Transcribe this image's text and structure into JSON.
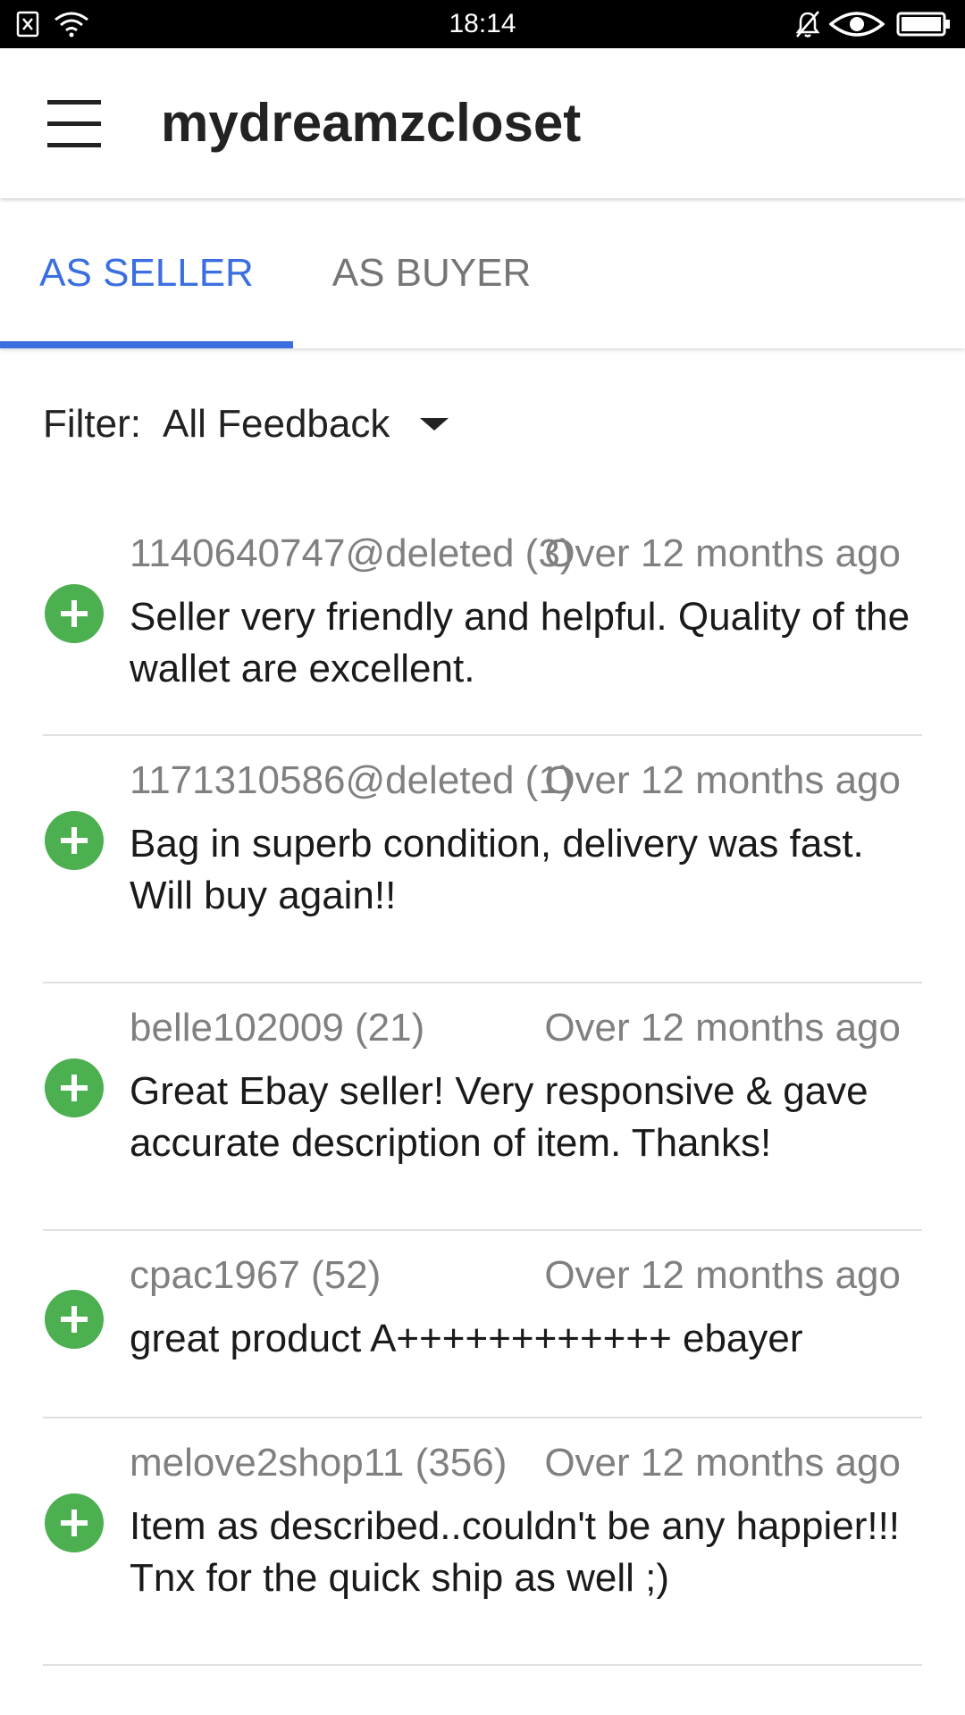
{
  "status_bar": {
    "time": "18:14",
    "icons_left": [
      "sim-card-icon",
      "wifi-icon"
    ],
    "icons_right": [
      "bell-off-icon",
      "eye-icon",
      "battery-icon"
    ]
  },
  "app_bar": {
    "menu_icon": "hamburger-menu-icon",
    "title": "mydreamzcloset"
  },
  "tabs": [
    {
      "label": "AS SELLER",
      "active": true
    },
    {
      "label": "AS BUYER",
      "active": false
    }
  ],
  "filter": {
    "label": "Filter:",
    "value": "All Feedback"
  },
  "colors": {
    "accent": "#3b6fe0",
    "positive": "#4caf50",
    "muted_text": "#808080"
  },
  "feedback": [
    {
      "user": "1140640747@deleted (3)",
      "time": "Over 12 months ago",
      "comment": "Seller very friendly and helpful. Quality of the wallet are excellent.",
      "type": "positive-icon"
    },
    {
      "user": "1171310586@deleted (1)",
      "time": "Over 12 months ago",
      "comment": "Bag in superb condition, delivery was fast. Will buy again!!",
      "type": "positive-icon"
    },
    {
      "user": "belle102009 (21)",
      "time": "Over 12 months ago",
      "comment": "Great Ebay seller! Very responsive & gave accurate description of item. Thanks!",
      "type": "positive-icon"
    },
    {
      "user": "cpac1967 (52)",
      "time": "Over 12 months ago",
      "comment": "great product A++++++++++++ ebayer",
      "type": "positive-icon"
    },
    {
      "user": "melove2shop11 (356)",
      "time": "Over 12 months ago",
      "comment": "Item as described..couldn't be any happier!!! Tnx for the quick ship as well ;)",
      "type": "positive-icon"
    }
  ]
}
